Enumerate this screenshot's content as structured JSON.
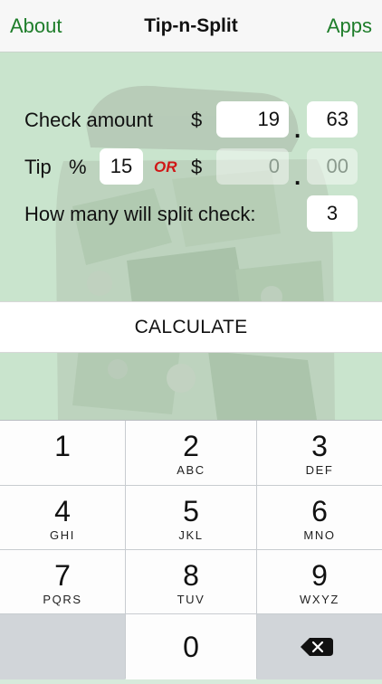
{
  "nav": {
    "left_label": "About",
    "title": "Tip-n-Split",
    "right_label": "Apps"
  },
  "form": {
    "check_label": "Check amount",
    "currency_symbol": "$",
    "check_dollars": "19",
    "check_cents": "63",
    "decimal": ".",
    "tip_label": "Tip",
    "percent_symbol": "%",
    "tip_percent": "15",
    "or_label": "OR",
    "tip_dollars_placeholder": "0",
    "tip_cents_placeholder": "00",
    "split_label": "How many will split check:",
    "split_count": "3"
  },
  "calculate_label": "CALCULATE",
  "keypad": {
    "keys": [
      {
        "num": "1",
        "letters": ""
      },
      {
        "num": "2",
        "letters": "ABC"
      },
      {
        "num": "3",
        "letters": "DEF"
      },
      {
        "num": "4",
        "letters": "GHI"
      },
      {
        "num": "5",
        "letters": "JKL"
      },
      {
        "num": "6",
        "letters": "MNO"
      },
      {
        "num": "7",
        "letters": "PQRS"
      },
      {
        "num": "8",
        "letters": "TUV"
      },
      {
        "num": "9",
        "letters": "WXYZ"
      },
      {
        "num": "0",
        "letters": ""
      }
    ]
  },
  "colors": {
    "accent": "#1e7d2a",
    "or_red": "#d01616",
    "form_bg": "#c9e4cd"
  },
  "icons": {
    "background": "money-jar-image",
    "delete": "backspace-icon"
  }
}
